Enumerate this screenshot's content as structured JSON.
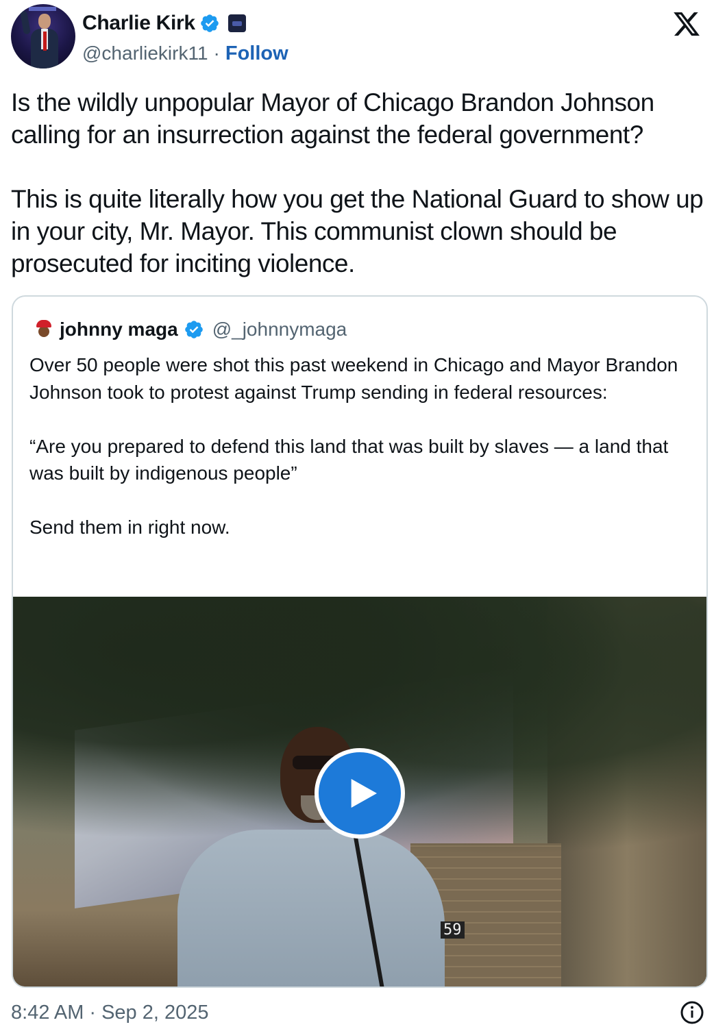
{
  "author": {
    "name": "Charlie Kirk",
    "handle": "@charliekirk11",
    "separator": "·",
    "follow_label": "Follow",
    "verified_color": "#1d9bf0"
  },
  "post": {
    "text": "Is the wildly unpopular Mayor of Chicago Brandon Johnson calling for an insurrection against the federal government?\n\nThis is quite literally how you get the National Guard to show up in your city, Mr. Mayor. This communist clown should be prosecuted for inciting violence."
  },
  "quote": {
    "name": "johnny maga",
    "handle": "@_johnnymaga",
    "text": "Over 50 people were shot this past weekend in Chicago and Mayor Brandon Johnson took to protest against Trump sending in federal resources:\n\n“Are you prepared to defend this land that was built by slaves — a land that was built by indigenous people”\n\nSend them in right now.",
    "video": {
      "sign_text": "59",
      "play_color": "#1d7ad9"
    }
  },
  "footer": {
    "time": "8:42 AM",
    "separator": "·",
    "date": "Sep 2, 2025"
  },
  "icons": {
    "brand": "x-logo-icon",
    "info": "info-icon",
    "play": "play-icon",
    "verified": "verified-badge-icon"
  }
}
